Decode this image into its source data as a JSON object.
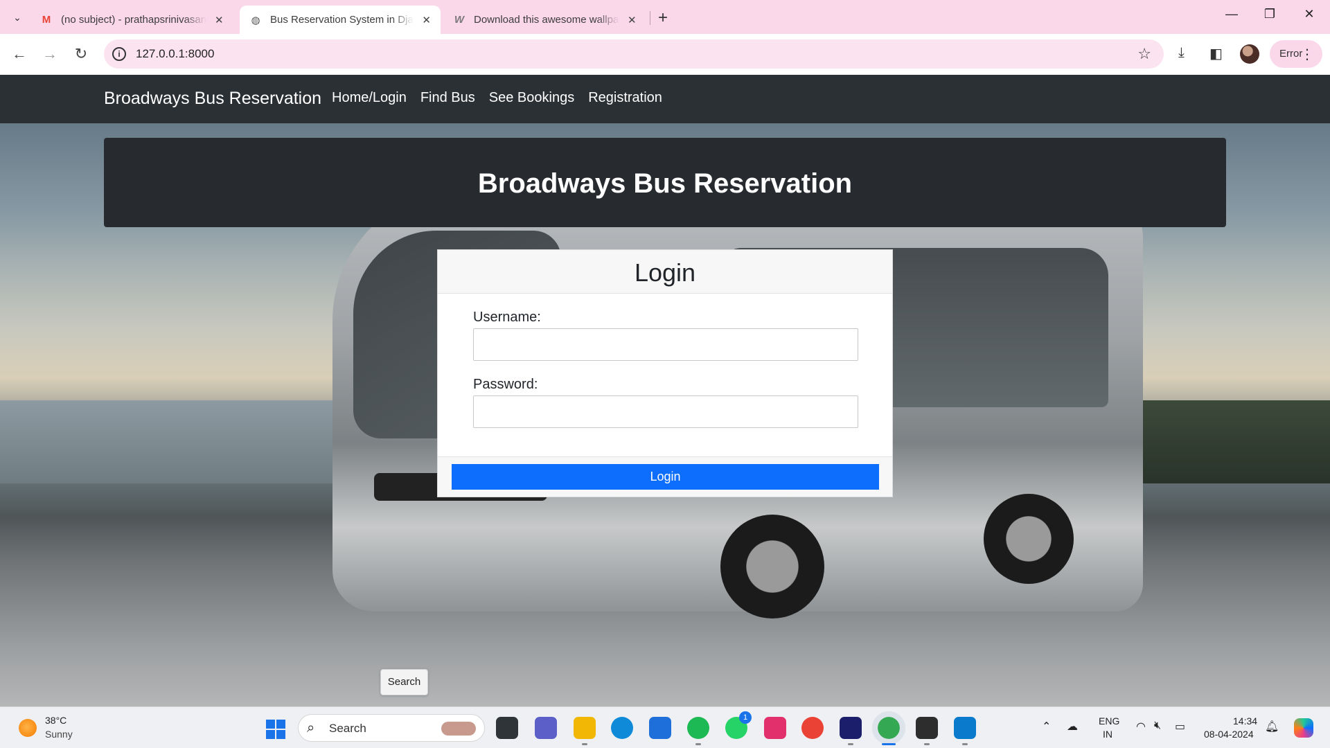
{
  "browser": {
    "tabs": [
      {
        "title": "(no subject) - prathapsrinivasan",
        "favicon": "gmail-icon"
      },
      {
        "title": "Bus Reservation System in Djan",
        "favicon": "globe-icon",
        "active": true
      },
      {
        "title": "Download this awesome wallpa",
        "favicon": "wallhaven-icon"
      }
    ],
    "url": "127.0.0.1:8000",
    "profile_status": "Error"
  },
  "site": {
    "brand": "Broadways Bus Reservation",
    "nav": [
      "Home/Login",
      "Find Bus",
      "See Bookings",
      "Registration"
    ],
    "hero_title": "Broadways Bus Reservation"
  },
  "login_card": {
    "heading": "Login",
    "username_label": "Username:",
    "username_value": "",
    "password_label": "Password:",
    "password_value": "",
    "submit_label": "Login"
  },
  "tooltip": "Search",
  "taskbar": {
    "weather": {
      "temp": "38°C",
      "condition": "Sunny"
    },
    "search_placeholder": "Search",
    "whatsapp_badge": "1",
    "lang_line1": "ENG",
    "lang_line2": "IN",
    "time": "14:34",
    "date": "08-04-2024"
  },
  "colors": {
    "navbar": "#2b3035",
    "primary_button": "#0d6efd",
    "tab_strip": "#fbd7ea"
  }
}
